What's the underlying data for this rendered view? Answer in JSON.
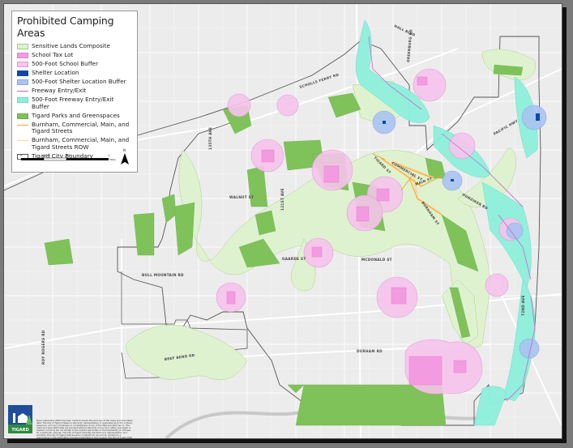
{
  "legend": {
    "title": "Prohibited Camping Areas",
    "items": [
      {
        "label": "Sensitive Lands Composite",
        "fill": "#dff2d0",
        "stroke": "#9ccc86",
        "kind": "box"
      },
      {
        "label": "School Tax Lot",
        "fill": "#f39be0",
        "stroke": "#e67fd2",
        "kind": "box"
      },
      {
        "label": "500-Foot School Buffer",
        "fill": "#f6c4ec",
        "stroke": "#df9ad2",
        "kind": "box"
      },
      {
        "label": "Shelter Location",
        "fill": "#0b4aa8",
        "stroke": "#0b4aa8",
        "kind": "box"
      },
      {
        "label": "500-Foot Shelter Location Buffer",
        "fill": "#a9c4f2",
        "stroke": "#8aa8e0",
        "kind": "box"
      },
      {
        "label": "Freeway Entry/Exit",
        "fill": "none",
        "stroke": "#c36ac6",
        "kind": "line"
      },
      {
        "label": "500-Foot Freeway Entry/Exit Buffer",
        "fill": "#8ef0dc",
        "stroke": "#6fd8c4",
        "kind": "box"
      },
      {
        "label": "Tigard Parks and Greenspaces",
        "fill": "#7fc25a",
        "stroke": "#6aae48",
        "kind": "box"
      },
      {
        "label": "Burnham, Commercial, Main, and Tigard Streets",
        "fill": "none",
        "stroke": "#f0a830",
        "kind": "line"
      },
      {
        "label": "Burnham, Commercial, Main, and Tigard Streets ROW",
        "fill": "none",
        "stroke": "#f9d9a0",
        "kind": "line"
      },
      {
        "label": "Tigard City Boundary",
        "fill": "#ffffff",
        "stroke": "#555555",
        "kind": "box"
      }
    ],
    "scale_labels": [
      "0",
      "0.25",
      "0.5",
      "1"
    ],
    "scale_unit": "Miles",
    "north_label": "N"
  },
  "roads": {
    "scholls_ferry": "SCHOLLS FERRY RD",
    "hall": "HALL BLVD",
    "greenburg": "GREENBURG RD",
    "pacific": "PACIFIC HWY",
    "ave135": "135TH AVE",
    "walnut": "WALNUT ST",
    "ave121": "121ST AVE",
    "tigard": "TIGARD ST",
    "commercial": "COMMERCIAL ST",
    "main": "MAIN ST",
    "burnham": "BURNHAM ST",
    "hunziker": "HUNZIKER RD",
    "gaarde": "GAARDE ST",
    "mcdonald": "MCDONALD ST",
    "bull_mountain": "BULL MOUNTAIN RD",
    "roy_rogers": "ROY ROGERS RD",
    "beef_bend": "BEEF BEND RD",
    "durham": "DURHAM RD",
    "ave72": "72ND AVE"
  },
  "logo": {
    "label": "TIGARD"
  },
  "disclaimer": "Every reasonable effort has been made to assure the accuracy of the maps and associated data. The City of Tigard makes no warranty, representation or guarantee as to the content, sequence, accuracy, timeliness or completeness of any of the data provided herein. The maps and associated data are provided without warranty of any kind, either expressed or implied, including but not limited to the implied warranties of merchantability and fitness for a particular purpose. The City of Tigard explicitly disclaims any representation and warranty. The City of Tigard shall assume no liability for any errors, omissions, or inaccuracies in the information provided regardless of how caused. The City of Tigard shall assume no liability for any decisions made or actions taken or not taken by any person relying on any information or data furnished hereunder."
}
